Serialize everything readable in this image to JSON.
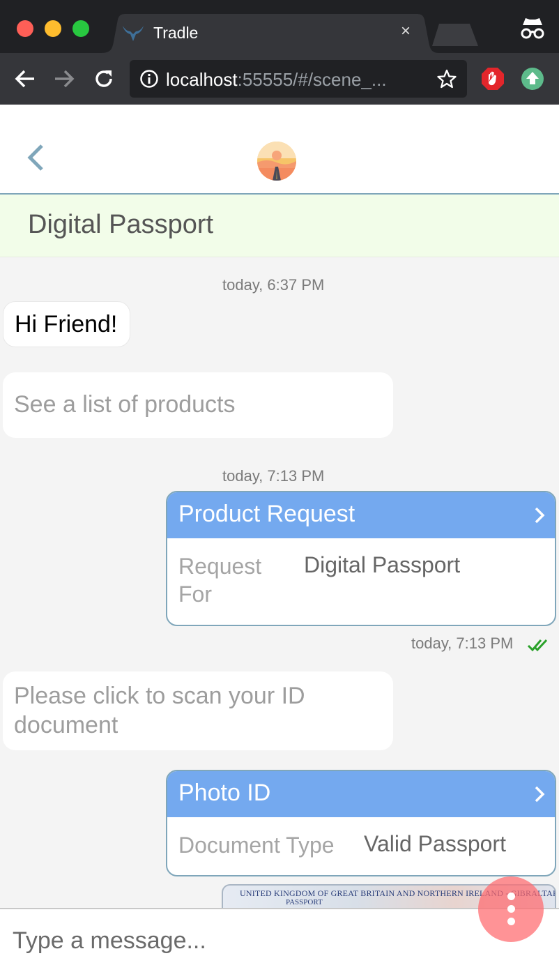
{
  "browser": {
    "tab_title": "Tradle",
    "tab_close": "×",
    "url_host": "localhost",
    "url_rest": ":55555/#/scene_..."
  },
  "header": {
    "back_icon": "chevron-left-icon",
    "avatar_icon": "sunset-road-avatar"
  },
  "banner": {
    "title": "Digital Passport"
  },
  "messages": {
    "ts1": "today, 6:37 PM",
    "greeting": "Hi Friend!",
    "products_link": "See a list of products",
    "ts2": "today, 7:13 PM",
    "product_request": {
      "title": "Product Request",
      "label_line1": "Request",
      "label_line2": "For",
      "value": "Digital Passport"
    },
    "ts3": "today, 7:13 PM",
    "scan_prompt_line1": "Please click to scan your ID",
    "scan_prompt_line2": "document",
    "photo_id": {
      "title": "Photo ID",
      "label": "Document Type",
      "value": "Valid Passport"
    },
    "passport_header": "UNITED KINGDOM OF GREAT BRITAIN AND NORTHERN IRELAND - GIBRALTAR",
    "passport_sub": "PASSPORT"
  },
  "composer": {
    "placeholder": "Type a message..."
  },
  "colors": {
    "card_header": "#74a9ef",
    "banner_bg": "#f2fde9",
    "fab": "#ff696e",
    "delivered_check": "#2aa12a"
  }
}
